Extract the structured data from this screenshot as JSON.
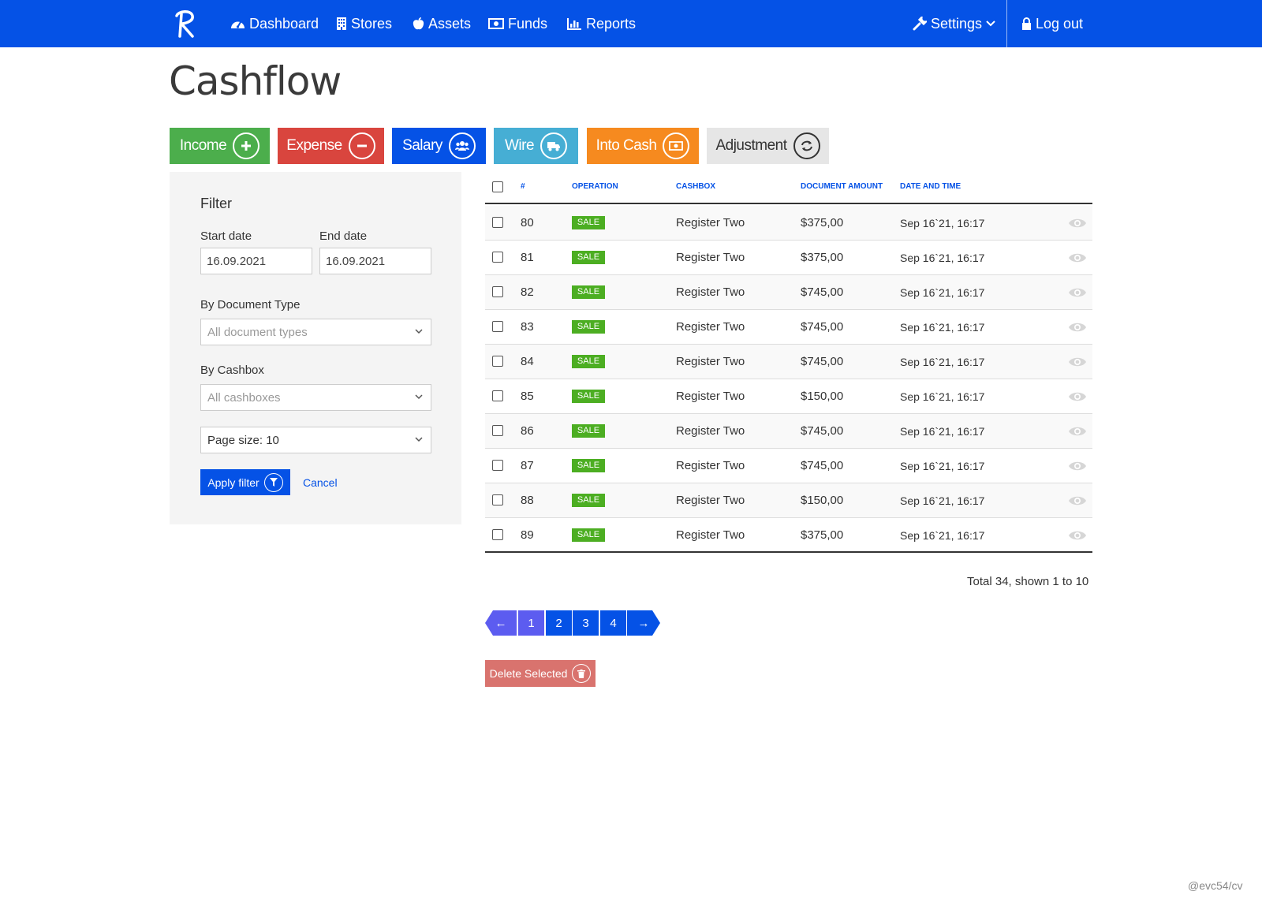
{
  "navbar": {
    "brand_icon": "r-logo",
    "items": [
      {
        "label": "Dashboard",
        "icon": "dashboard-icon"
      },
      {
        "label": "Stores",
        "icon": "building-icon"
      },
      {
        "label": "Assets",
        "icon": "apple-icon"
      },
      {
        "label": "Funds",
        "icon": "money-icon"
      },
      {
        "label": "Reports",
        "icon": "bar-chart-icon"
      }
    ],
    "settings_label": "Settings",
    "logout_label": "Log out"
  },
  "page": {
    "title": "Cashflow"
  },
  "actions": {
    "income": "Income",
    "expense": "Expense",
    "salary": "Salary",
    "wire": "Wire",
    "into_cash": "Into Cash",
    "adjustment": "Adjustment"
  },
  "filter": {
    "title": "Filter",
    "start_date_label": "Start date",
    "start_date_value": "16.09.2021",
    "end_date_label": "End date",
    "end_date_value": "16.09.2021",
    "doc_type_label": "By Document Type",
    "doc_type_value": "All document types",
    "cashbox_label": "By Cashbox",
    "cashbox_value": "All cashboxes",
    "page_size_value": "Page size: 10",
    "apply_label": "Apply filter",
    "cancel_label": "Cancel"
  },
  "table": {
    "headers": [
      "#",
      "Operation",
      "Cashbox",
      "Document amount",
      "Date and time"
    ],
    "rows": [
      {
        "num": "80",
        "operation": "SALE",
        "cashbox": "Register Two",
        "amount": "$375,00",
        "datetime": "Sep 16`21, 16:17"
      },
      {
        "num": "81",
        "operation": "SALE",
        "cashbox": "Register Two",
        "amount": "$375,00",
        "datetime": "Sep 16`21, 16:17"
      },
      {
        "num": "82",
        "operation": "SALE",
        "cashbox": "Register Two",
        "amount": "$745,00",
        "datetime": "Sep 16`21, 16:17"
      },
      {
        "num": "83",
        "operation": "SALE",
        "cashbox": "Register Two",
        "amount": "$745,00",
        "datetime": "Sep 16`21, 16:17"
      },
      {
        "num": "84",
        "operation": "SALE",
        "cashbox": "Register Two",
        "amount": "$745,00",
        "datetime": "Sep 16`21, 16:17"
      },
      {
        "num": "85",
        "operation": "SALE",
        "cashbox": "Register Two",
        "amount": "$150,00",
        "datetime": "Sep 16`21, 16:17"
      },
      {
        "num": "86",
        "operation": "SALE",
        "cashbox": "Register Two",
        "amount": "$745,00",
        "datetime": "Sep 16`21, 16:17"
      },
      {
        "num": "87",
        "operation": "SALE",
        "cashbox": "Register Two",
        "amount": "$745,00",
        "datetime": "Sep 16`21, 16:17"
      },
      {
        "num": "88",
        "operation": "SALE",
        "cashbox": "Register Two",
        "amount": "$150,00",
        "datetime": "Sep 16`21, 16:17"
      },
      {
        "num": "89",
        "operation": "SALE",
        "cashbox": "Register Two",
        "amount": "$375,00",
        "datetime": "Sep 16`21, 16:17"
      }
    ],
    "total_info": "Total 34, shown 1 to 10"
  },
  "pagination": {
    "prev": "←",
    "pages": [
      "1",
      "2",
      "3",
      "4"
    ],
    "next": "→",
    "active_page": "1"
  },
  "delete_label": "Delete Selected",
  "watermark": "@evc54/cv",
  "colors": {
    "primary": "#0552e6",
    "income": "#4cae4c",
    "expense": "#d9453e",
    "wire": "#46aed4",
    "into_cash": "#f68a1f",
    "sale_badge": "#4cae22",
    "delete": "#d9736e"
  }
}
